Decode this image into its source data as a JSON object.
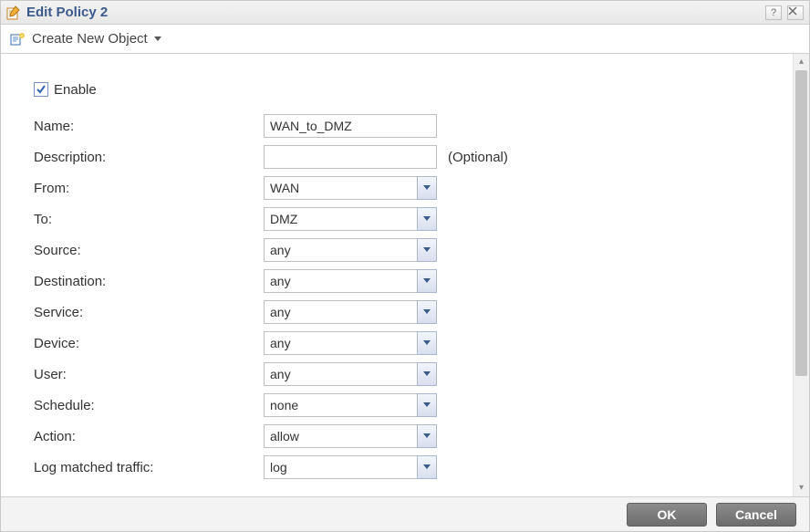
{
  "title": "Edit Policy 2",
  "toolbar": {
    "create_label": "Create New Object"
  },
  "form": {
    "enable_label": "Enable",
    "enable_checked": true,
    "optional": "(Optional)",
    "fields": {
      "name": {
        "label": "Name:",
        "value": "WAN_to_DMZ",
        "type": "text"
      },
      "description": {
        "label": "Description:",
        "value": "",
        "type": "text"
      },
      "from": {
        "label": "From:",
        "value": "WAN",
        "type": "combo"
      },
      "to": {
        "label": "To:",
        "value": "DMZ",
        "type": "combo"
      },
      "source": {
        "label": "Source:",
        "value": "any",
        "type": "combo"
      },
      "destination": {
        "label": "Destination:",
        "value": "any",
        "type": "combo"
      },
      "service": {
        "label": "Service:",
        "value": "any",
        "type": "combo"
      },
      "device": {
        "label": "Device:",
        "value": "any",
        "type": "combo"
      },
      "user": {
        "label": "User:",
        "value": "any",
        "type": "combo"
      },
      "schedule": {
        "label": "Schedule:",
        "value": "none",
        "type": "combo"
      },
      "action": {
        "label": "Action:",
        "value": "allow",
        "type": "combo"
      },
      "log": {
        "label": "Log matched traffic:",
        "value": "log",
        "type": "combo"
      }
    }
  },
  "buttons": {
    "ok": "OK",
    "cancel": "Cancel"
  }
}
